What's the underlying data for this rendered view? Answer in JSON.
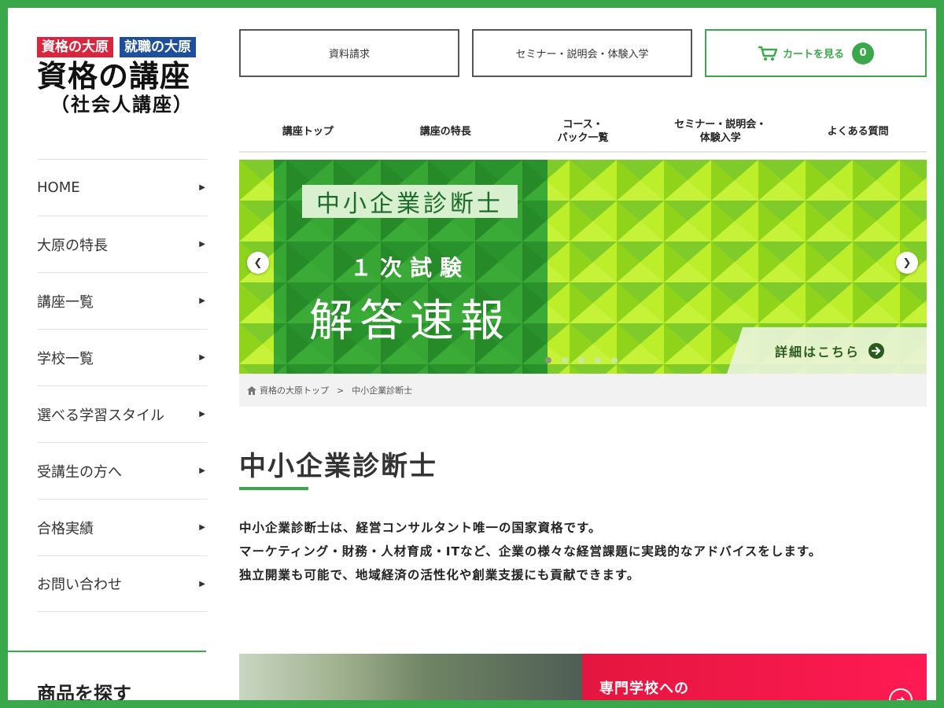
{
  "logo": {
    "badge_left": "資格の大原",
    "badge_right": "就職の大原",
    "title": "資格の講座",
    "subtitle": "（社会人講座）"
  },
  "sidebar": {
    "items": [
      {
        "label": "HOME"
      },
      {
        "label": "大原の特長"
      },
      {
        "label": "講座一覧"
      },
      {
        "label": "学校一覧"
      },
      {
        "label": "選べる学習スタイル"
      },
      {
        "label": "受講生の方へ"
      },
      {
        "label": "合格実績"
      },
      {
        "label": "お問い合わせ"
      }
    ],
    "heading": "商品を探す"
  },
  "header": {
    "request_label": "資料請求",
    "seminar_label": "セミナー・説明会・体験入学",
    "cart_label": "カートを見る",
    "cart_count": "0"
  },
  "subnav": {
    "items": [
      {
        "label": "講座トップ"
      },
      {
        "label": "講座の特長"
      },
      {
        "label": "コース・\nパック一覧"
      },
      {
        "label": "セミナー・説明会・\n体験入学"
      },
      {
        "label": "よくある質問"
      }
    ]
  },
  "banner": {
    "tag": "中小企業診断士",
    "line1": "１次試験",
    "line2": "解答速報",
    "detail": "詳細はこちら",
    "slide_count": 5,
    "active_slide": 1,
    "colors": {
      "dark_green": "#2e9a2f",
      "lime": "#9bdc1e"
    }
  },
  "breadcrumb": {
    "home": "資格の大原トップ",
    "separator": ">",
    "current": "中小企業診断士"
  },
  "main": {
    "title": "中小企業診断士",
    "description": [
      "中小企業診断士は、経営コンサルタント唯一の国家資格です。",
      "マーケティング・財務・人材育成・ITなど、企業の様々な経営課題に実践的なアドバイスをします。",
      "独立開業も可能で、地域経済の活性化や創業支援にも貢献できます。"
    ]
  },
  "promo": {
    "text": "専門学校への"
  },
  "theme": {
    "accent": "#3aa84a",
    "red": "#d7263d",
    "blue": "#1d4f9a"
  }
}
